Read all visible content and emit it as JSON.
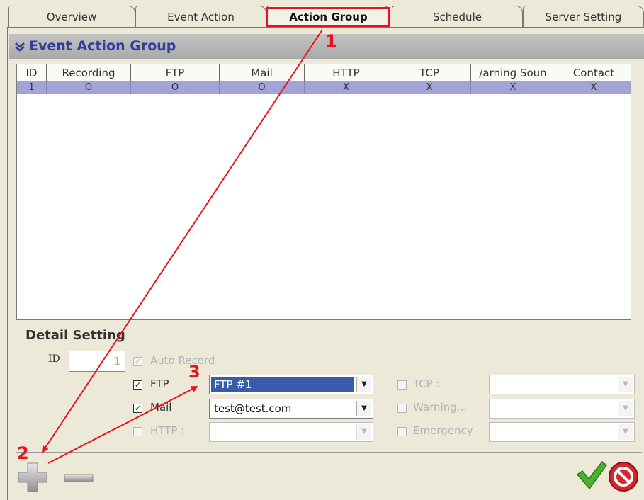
{
  "tabs": [
    {
      "label": "Overview"
    },
    {
      "label": "Event Action"
    },
    {
      "label": "Action Group",
      "active": true
    },
    {
      "label": "Schedule"
    },
    {
      "label": "Server Setting"
    }
  ],
  "section": {
    "title": "Event Action Group"
  },
  "table": {
    "columns": [
      "ID",
      "Recording",
      "FTP",
      "Mail",
      "HTTP",
      "TCP",
      "/arning Soun",
      "Contact"
    ],
    "rows": [
      [
        "1",
        "O",
        "O",
        "O",
        "X",
        "X",
        "X",
        "X"
      ]
    ],
    "selected_row_color": "#a2a4d8"
  },
  "detail": {
    "legend": "Detail Setting",
    "id_label": "ID",
    "id_value": "1",
    "auto_record": {
      "label": "Auto Record",
      "checked": true,
      "enabled": false
    },
    "ftp": {
      "label": "FTP",
      "checked": true,
      "value": "FTP #1"
    },
    "mail": {
      "label": "Mail",
      "checked": true,
      "value": "test@test.com"
    },
    "http": {
      "label": "HTTP :",
      "checked": false,
      "enabled": false,
      "value": ""
    },
    "tcp": {
      "label": "TCP :",
      "checked": false,
      "enabled": false,
      "value": ""
    },
    "warning": {
      "label": "Warning...",
      "checked": false,
      "enabled": false,
      "value": ""
    },
    "emergency": {
      "label": "Emergency",
      "checked": false,
      "enabled": false,
      "value": ""
    }
  },
  "buttons": {
    "add": "add-icon",
    "remove": "remove-icon",
    "confirm": "checkmark-icon",
    "cancel": "cancel-icon"
  },
  "annotations": {
    "steps": [
      "1",
      "2",
      "3"
    ],
    "color": "#e8141b"
  }
}
